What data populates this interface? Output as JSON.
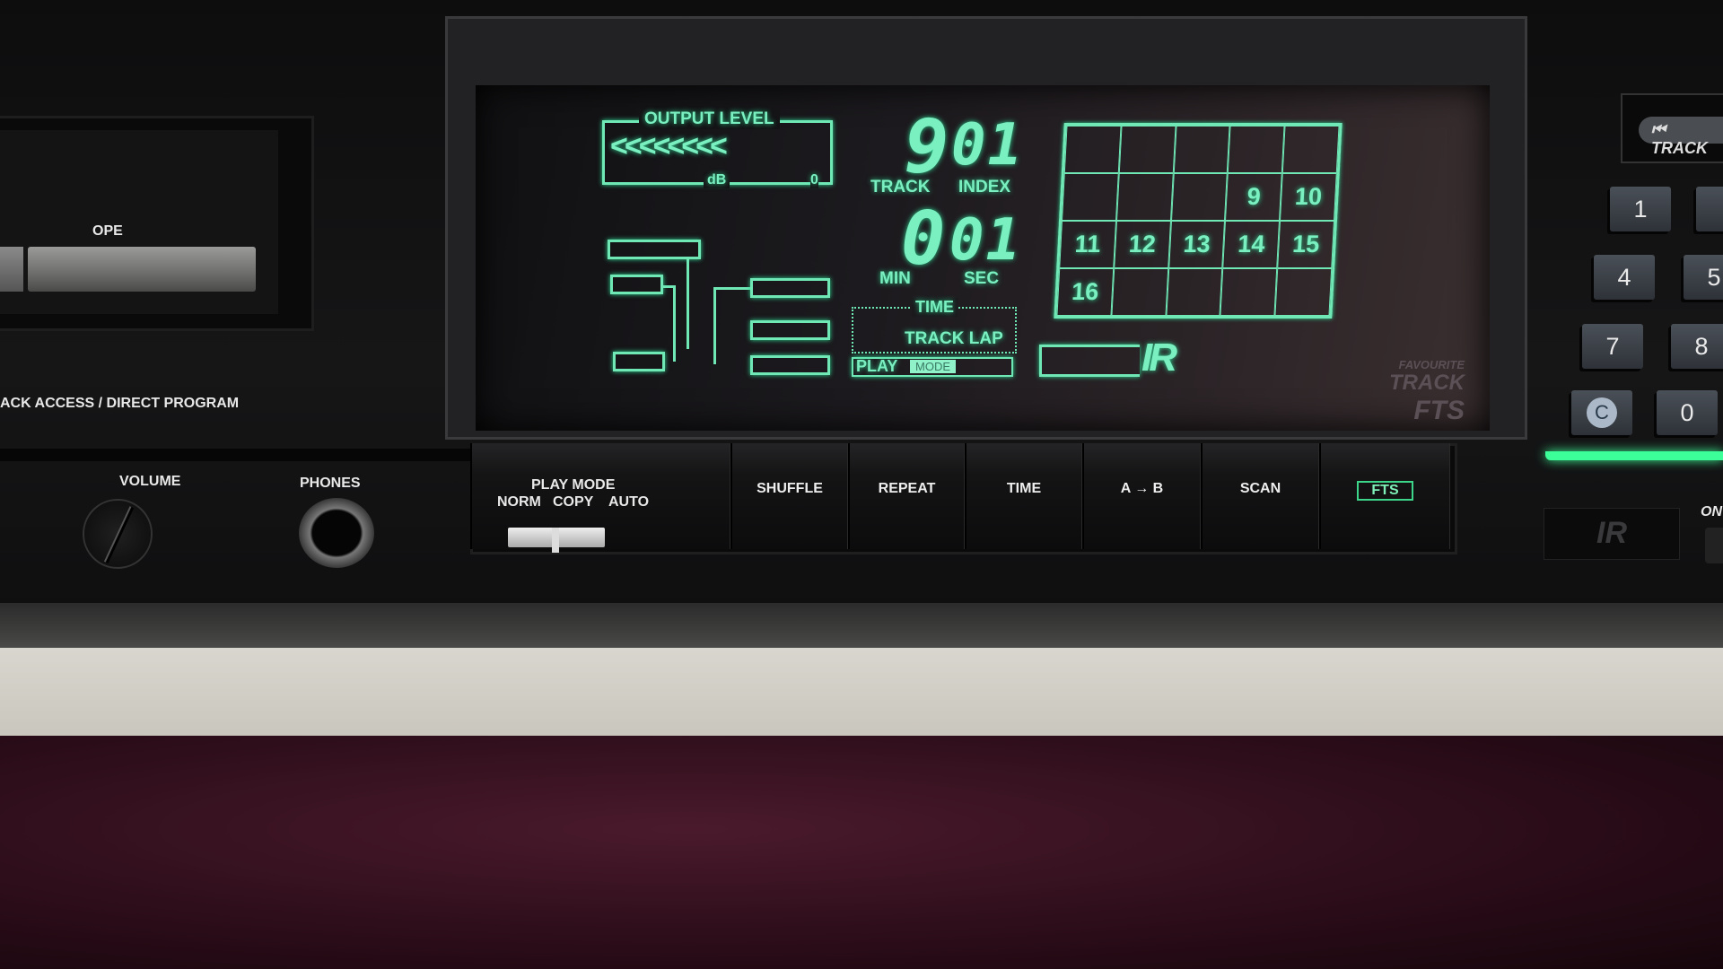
{
  "left_panel": {
    "open_label": "OPE",
    "access_label": "ACK ACCESS / DIRECT PROGRAM",
    "volume_label": "VOLUME",
    "phones_label": "PHONES"
  },
  "display": {
    "output_level_label": "OUTPUT LEVEL",
    "db_label": "dB",
    "zero_label": "0",
    "level_chevrons": "<<<<<<<<",
    "track_value": "9",
    "index_value": "01",
    "track_label": "TRACK",
    "index_label": "INDEX",
    "min_value": "0",
    "sec_value": "01",
    "min_label": "MIN",
    "sec_label": "SEC",
    "time_label": "TIME",
    "track_lap_label": "TRACK LAP",
    "play_label": "PLAY",
    "mode_label": "MODE",
    "grid_cells": [
      "",
      "",
      "",
      "",
      "",
      "",
      "",
      "",
      "9",
      "10",
      "11",
      "12",
      "13",
      "14",
      "15",
      "16",
      "",
      "",
      "",
      ""
    ],
    "ir_logo": "IR",
    "fts_logo": "FAVOURITE TRACK FTS",
    "color": "#6fe8b6"
  },
  "buttons": {
    "play_mode_label": "PLAY MODE",
    "norm": "NORM",
    "copy": "COPY",
    "auto": "AUTO",
    "shuffle": "SHUFFLE",
    "repeat": "REPEAT",
    "time": "TIME",
    "ab": "A → B",
    "scan": "SCAN",
    "fts": "FTS"
  },
  "right_panel": {
    "track_button": "TRACK",
    "keys": [
      "1",
      "4",
      "7",
      "C",
      "",
      "5",
      "8",
      "0"
    ],
    "ir_window_logo": "IR",
    "on_label": "ON",
    "led_color": "#3dff9a"
  }
}
